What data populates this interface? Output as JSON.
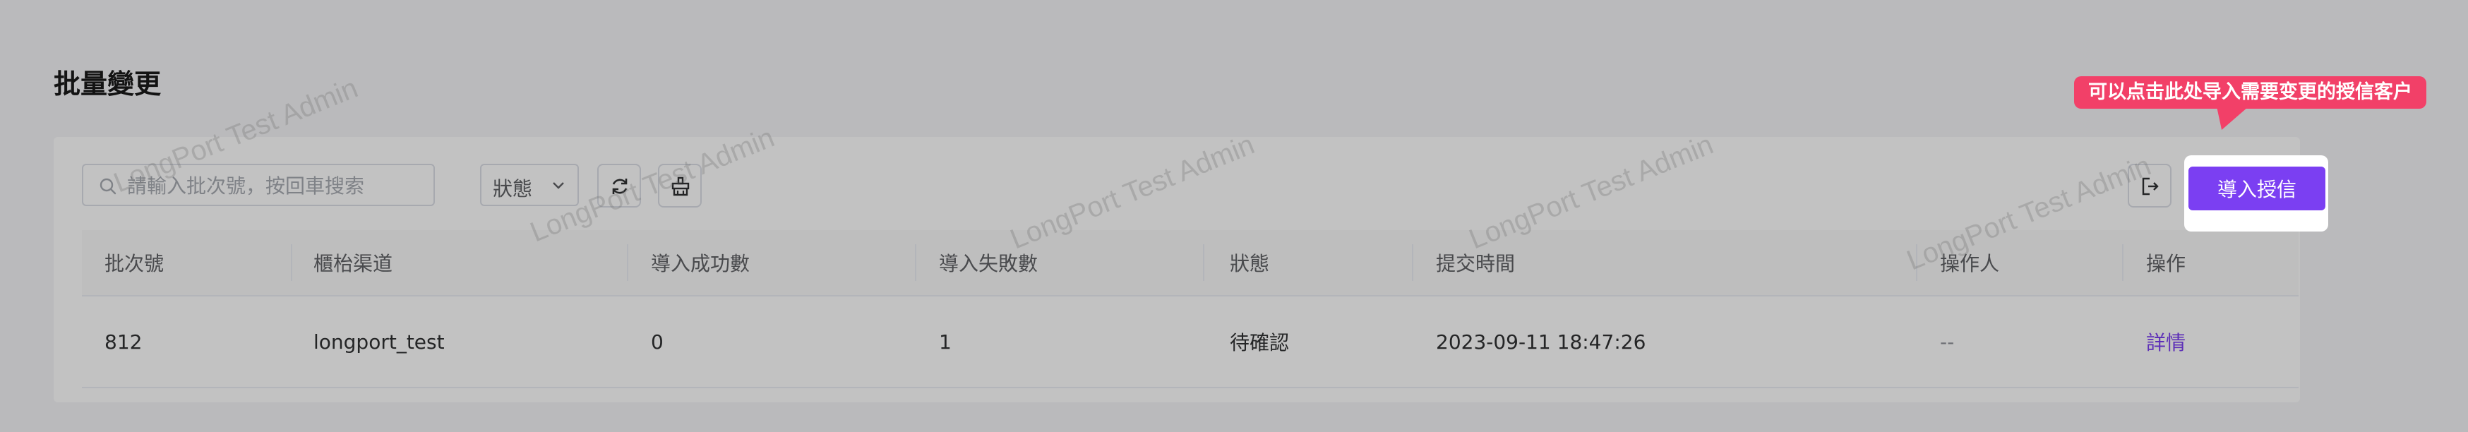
{
  "page": {
    "title": "批量變更"
  },
  "toolbar": {
    "search_placeholder": "請輸入批次號，按回車搜索",
    "search_icon": "search-icon",
    "status_filter_label": "狀態",
    "refresh_icon": "refresh-icon",
    "clear_icon": "clear-filter-icon",
    "export_icon": "export-icon",
    "import_button_label": "導入授信"
  },
  "table": {
    "columns": [
      "批次號",
      "櫃枱渠道",
      "導入成功數",
      "導入失敗數",
      "狀態",
      "提交時間",
      "操作人",
      "操作"
    ],
    "rows": [
      {
        "batch_no": "812",
        "channel": "longport_test",
        "success_count": "0",
        "failure_count": "1",
        "status": "待確認",
        "submit_time": "2023-09-11 18:47:26",
        "operator": "--",
        "action": "詳情"
      }
    ]
  },
  "guide": {
    "tooltip": "可以点击此处导入需要变更的授信客户"
  },
  "watermark": {
    "text": "LongPort Test Admin"
  },
  "colors": {
    "accent": "#7b3ff2",
    "tooltip": "#f24068"
  }
}
